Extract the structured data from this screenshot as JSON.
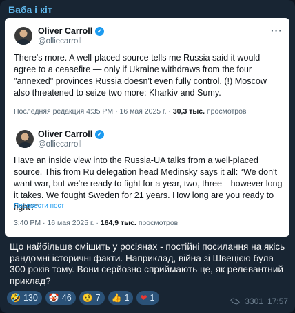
{
  "channel": {
    "name": "Баба і кіт"
  },
  "tweet": {
    "author": "Oliver Carroll",
    "handle": "@olliecarroll",
    "text": "There's more. A well-placed source tells me Russia said it would agree to a ceasefire — only if Ukraine withdraws from the four \"annexed\" provinces Russia doesn't even fully control. (!) Moscow also threatened to seize two more: Kharkiv and Sumy.",
    "meta_prefix": "Последняя редакция 4:35 PM · 16 мая 2025 г. · ",
    "views": "30,3 тыс.",
    "views_label": " просмотров",
    "more_icon": "more-icon"
  },
  "quoted_tweet": {
    "author": "Oliver Carroll",
    "handle": "@olliecarroll",
    "text": "Have an inside view into the Russia-UA talks from a well-placed source. This from Ru delegation head Medinsky says it all: “We don't want war, but we're ready to fight for a year, two, three—however long it takes. We fought Sweden for 21 years. How long are you ready to fight?”",
    "translate": "Перевести пост",
    "meta_prefix": "3:40 PM · 16 мая 2025 г. · ",
    "views": "164,9 тыс.",
    "views_label": " просмотров"
  },
  "message": {
    "text": "Що найбільше смішить у росіянах - постійні посилання на якісь рандомні історичні факти. Наприклад, війна зі Швецією була 300 років тому. Вони серйозно сприймають це, як релевантний приклад?"
  },
  "reactions": [
    {
      "emoji": "🤣",
      "icon": "rofl-emoji-icon",
      "count": "130"
    },
    {
      "emoji": "🤡",
      "icon": "clown-emoji-icon",
      "count": "46"
    },
    {
      "emoji": "🤨",
      "icon": "raised-eyebrow-emoji-icon",
      "count": "7"
    },
    {
      "emoji": "👍",
      "icon": "thumbs-up-emoji-icon",
      "count": "1"
    },
    {
      "emoji": "❤",
      "icon": "heart-emoji-icon",
      "count": "1"
    }
  ],
  "footer": {
    "views": "3301",
    "time": "17:57"
  },
  "colors": {
    "accent": "#5fb5e8",
    "bubble": "#182533",
    "reaction_bg": "#2b5278",
    "verified": "#1d9bf0"
  }
}
